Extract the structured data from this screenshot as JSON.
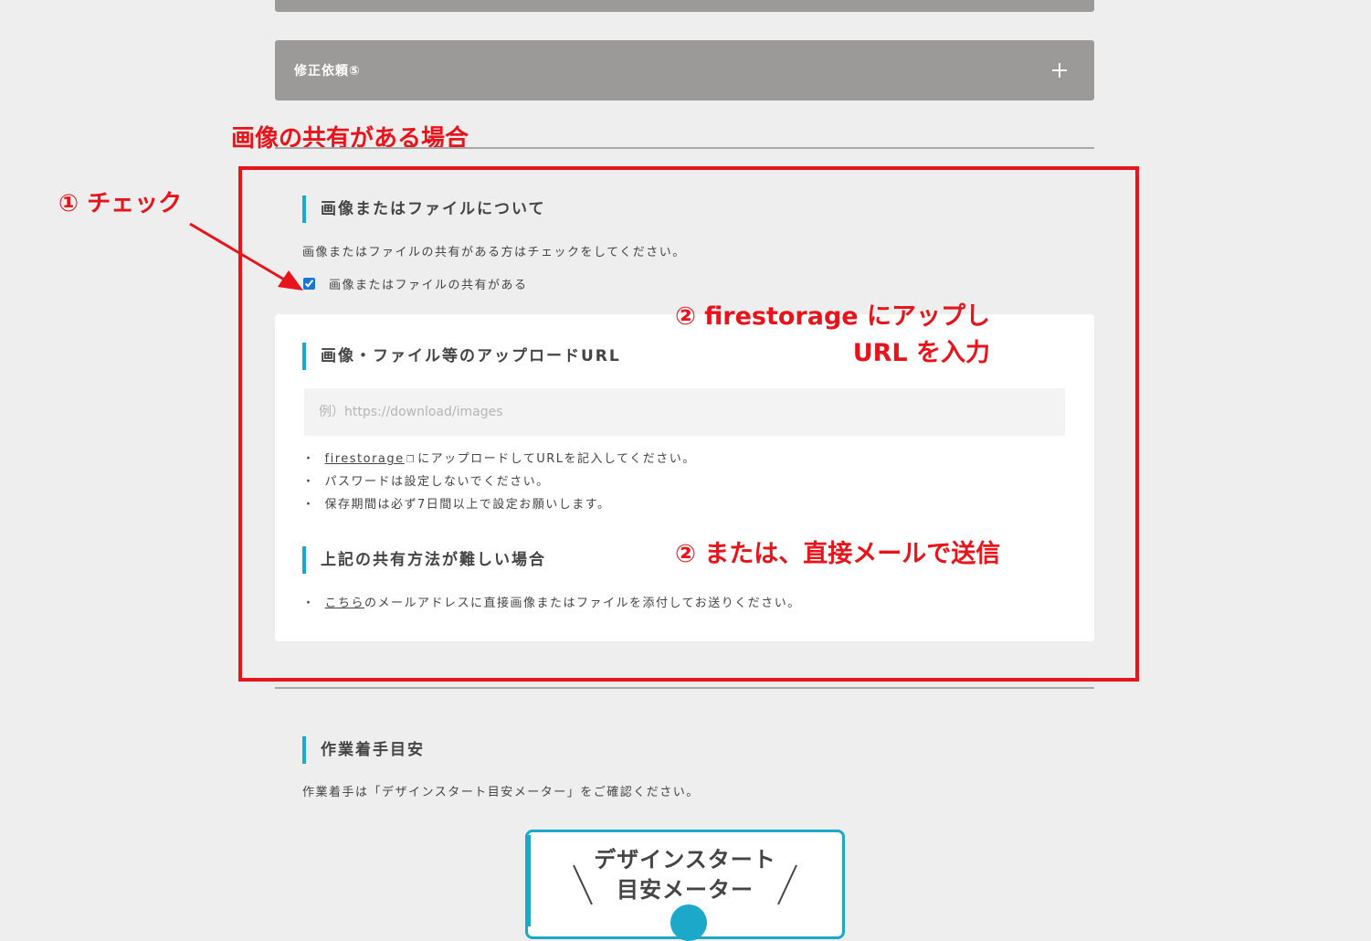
{
  "accordion": {
    "label": "修正依頼⑤"
  },
  "annotations": {
    "heading": "画像の共有がある場合",
    "step1": "① チェック",
    "step2_line1": "② firestorage にアップし",
    "step2_line2": "URL を入力",
    "step2b": "② または、直接メールで送信",
    "color": "#e8141b"
  },
  "image_file_section": {
    "heading": "画像またはファイルについて",
    "description": "画像またはファイルの共有がある方はチェックをしてください。",
    "checkbox_label": "画像またはファイルの共有がある",
    "checked": true
  },
  "upload_section": {
    "heading": "画像・ファイル等のアップロードURL",
    "placeholder": "例）https://download/images",
    "bullet_link": "firestorage",
    "bullet1_rest": "にアップロードしてURLを記入してください。",
    "bullet2": "パスワードは設定しないでください。",
    "bullet3": "保存期間は必ず7日間以上で設定お願いします。"
  },
  "difficult_section": {
    "heading": "上記の共有方法が難しい場合",
    "link": "こちら",
    "rest": "のメールアドレスに直接画像またはファイルを添付してお送りください。"
  },
  "work_section": {
    "heading": "作業着手目安",
    "description": "作業着手は「デザインスタート目安メーター」をご確認ください。"
  },
  "meter": {
    "title_line1": "デザインスタート",
    "title_line2": "目安メーター"
  },
  "colors": {
    "background": "#eeeeee",
    "accordion": "#9b9a98",
    "accent": "#1ba8c9",
    "annotation": "#e8141b"
  }
}
